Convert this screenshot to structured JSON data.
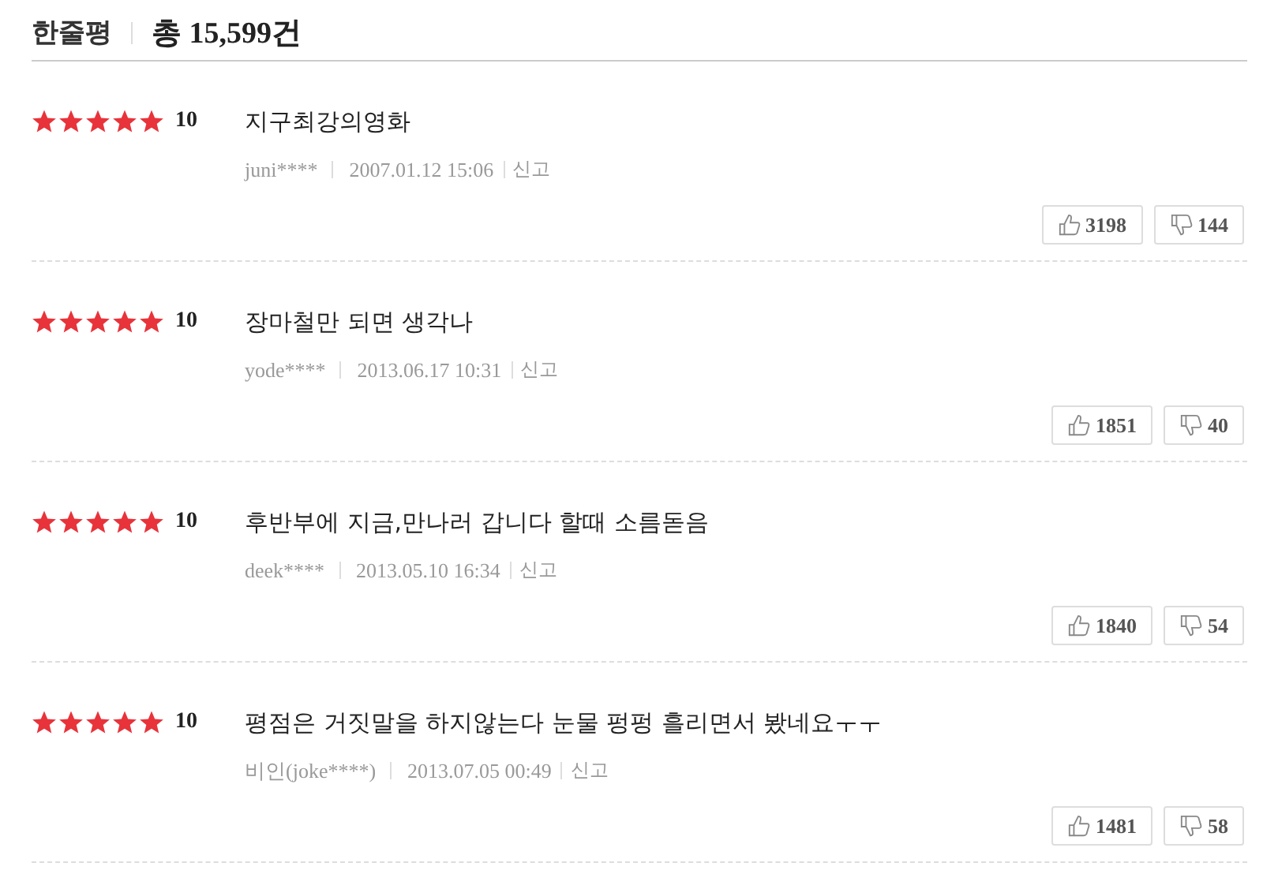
{
  "header": {
    "title": "한줄평",
    "total": "총 15,599건"
  },
  "reviews": [
    {
      "stars": 5,
      "score": "10",
      "text": "지구최강의영화",
      "author": "juni****",
      "date": "2007.01.12 15:06",
      "report": "신고",
      "likes": "3198",
      "dislikes": "144"
    },
    {
      "stars": 5,
      "score": "10",
      "text": "장마철만 되면 생각나",
      "author": "yode****",
      "date": "2013.06.17 10:31",
      "report": "신고",
      "likes": "1851",
      "dislikes": "40"
    },
    {
      "stars": 5,
      "score": "10",
      "text": "후반부에 지금,만나러 갑니다 할때 소름돋음",
      "author": "deek****",
      "date": "2013.05.10 16:34",
      "report": "신고",
      "likes": "1840",
      "dislikes": "54"
    },
    {
      "stars": 5,
      "score": "10",
      "text": "평점은 거짓말을 하지않는다 눈물 펑펑 흘리면서 봤네요ㅜㅜ",
      "author": "비인(joke****)",
      "date": "2013.07.05 00:49",
      "report": "신고",
      "likes": "1481",
      "dislikes": "58"
    }
  ]
}
